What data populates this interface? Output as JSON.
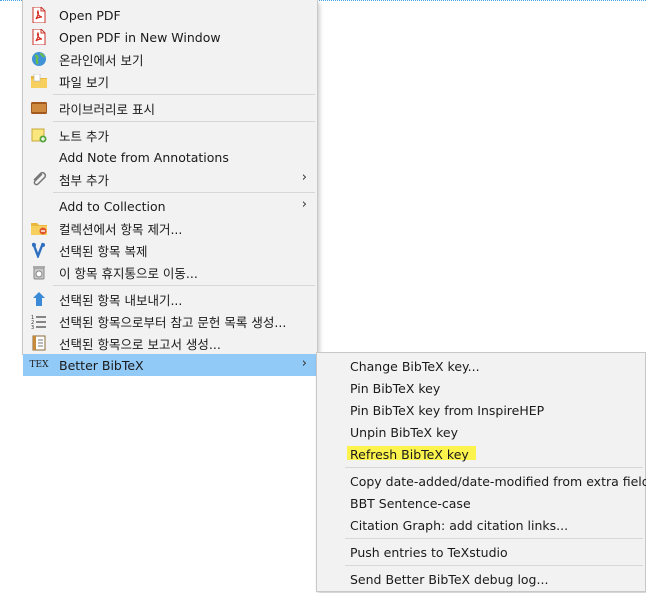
{
  "main_menu": {
    "items": [
      {
        "label": "Open PDF",
        "icon": "pdf-icon"
      },
      {
        "label": "Open PDF in New Window",
        "icon": "pdf-icon"
      },
      {
        "label": "온라인에서 보기",
        "icon": "globe-icon"
      },
      {
        "label": "파일 보기",
        "icon": "folder-icon"
      },
      {
        "label": "라이브러리로 표시",
        "icon": "library-icon"
      },
      {
        "label": "노트 추가",
        "icon": "note-add-icon"
      },
      {
        "label": "Add Note from Annotations",
        "icon": ""
      },
      {
        "label": "첨부 추가",
        "icon": "paperclip-icon",
        "submenu": true
      },
      {
        "label": "Add to Collection",
        "icon": "",
        "submenu": true
      },
      {
        "label": "컬렉션에서 항목 제거...",
        "icon": "folder-remove-icon"
      },
      {
        "label": "선택된 항목 복제",
        "icon": "duplicate-icon"
      },
      {
        "label": "이 항목 휴지통으로 이동...",
        "icon": "trash-icon"
      },
      {
        "label": "선택된 항목 내보내기...",
        "icon": "export-icon"
      },
      {
        "label": "선택된 항목으로부터 참고 문헌 목록 생성...",
        "icon": "bibliography-icon"
      },
      {
        "label": "선택된 항목으로 보고서 생성...",
        "icon": "report-icon"
      },
      {
        "label": "Better BibTeX",
        "icon": "tex-icon",
        "submenu": true,
        "active": true
      }
    ],
    "tex_icon_text": "TEX"
  },
  "sub_menu": {
    "items": [
      {
        "label": "Change BibTeX key..."
      },
      {
        "label": "Pin BibTeX key"
      },
      {
        "label": "Pin BibTeX key from InspireHEP"
      },
      {
        "label": "Unpin BibTeX key"
      },
      {
        "label": "Refresh BibTeX key",
        "highlighted": true
      },
      {
        "label": "Copy date-added/date-modified from extra field"
      },
      {
        "label": "BBT Sentence-case"
      },
      {
        "label": "Citation Graph: add citation links..."
      },
      {
        "label": "Push entries to TeXstudio"
      },
      {
        "label": "Send Better BibTeX debug log..."
      }
    ]
  },
  "submenu_arrow": "›",
  "colors": {
    "menu_bg": "#f2f2f2",
    "active_item": "#91c9f7",
    "highlight_marker": "#fdf33a"
  }
}
